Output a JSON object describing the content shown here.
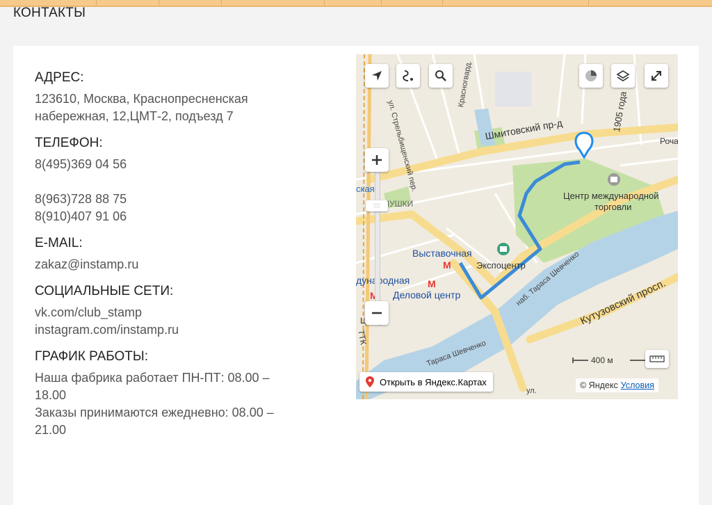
{
  "page": {
    "heading": "КОНТАКТЫ"
  },
  "contacts": {
    "address_title": "АДРЕС:",
    "address_lines": [
      "123610, Москва, Краснопресненская",
      "набережная, 12,ЦМТ-2, подъезд 7"
    ],
    "phone_title": "ТЕЛЕФОН:",
    "phones": [
      "8(495)369 04 56",
      "8(963)728 88 75",
      "8(910)407 91 06"
    ],
    "email_title": "E-MAIL:",
    "email": "zakaz@instamp.ru",
    "social_title": "СОЦИАЛЬНЫЕ СЕТИ:",
    "social_links": [
      "vk.com/club_stamp",
      "instagram.com/instamp.ru"
    ],
    "schedule_title": "ГРАФИК РАБОТЫ:",
    "schedule_lines": [
      "Наша фабрика работает ПН-ПТ: 08.00 –",
      "18.00",
      "Заказы принимаются ежедневно: 08.00 –",
      "21.00"
    ]
  },
  "map": {
    "labels": {
      "street_shmitovsky": "Шмитовский пр-д",
      "street_1905": "1905 года",
      "street_roch": "Роча",
      "street_strelbish": "ул. Стрельбищенский пер.",
      "street_krasnogvard": "Красногвард.",
      "wtc_line1": "Центр международной",
      "wtc_line2": "торговли",
      "district": "МУШКИ",
      "station_vystavochnaya": "Выставочная",
      "expocenter": "Экспоцентр",
      "station_delovoy": "Деловой центр",
      "station_mezhdunarodnaya": "дународная",
      "station_partial": "ская",
      "taras_upper": "наб. Тараса Шевченко",
      "taras_lower": "Тараса Шевченко",
      "kutuzovsky": "Кутузовский просп.",
      "ttk": "ТТК",
      "partial_bottom": "Центр",
      "partial_bottom2": "ул."
    },
    "open_in_yandex": "Открыть в Яндекс.Картах",
    "scale_label": "400 м",
    "copyright": "© Яндекс",
    "terms_link": "Условия",
    "zoom_handle": "::::"
  },
  "colors": {
    "route": "#3b8bd6",
    "river": "#b5d3e7",
    "park": "#c5e0a5",
    "major_road": "#f7dc8f",
    "metro": "#e53935",
    "topbar": "#f7c98a"
  },
  "icons": {
    "locate": "navigation-arrow-icon",
    "route": "route-icon",
    "search": "search-icon",
    "traffic": "traffic-icon",
    "layers": "layers-icon",
    "fullscreen": "fullscreen-icon",
    "zoom_in": "plus-icon",
    "zoom_out": "minus-icon",
    "ruler": "ruler-icon",
    "pin": "map-pin-icon"
  }
}
